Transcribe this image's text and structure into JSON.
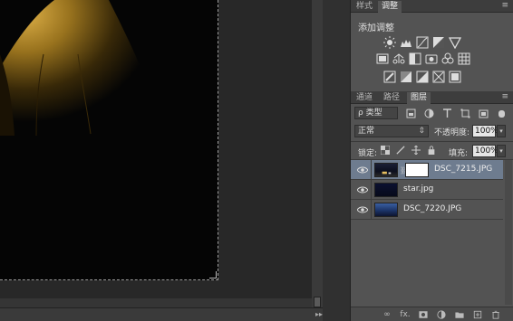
{
  "adjust_panel": {
    "tabs": [
      {
        "label": "样式"
      },
      {
        "label": "调整"
      }
    ],
    "title": "添加调整",
    "menu_icon": "panel-menu-icon"
  },
  "layers_panel": {
    "tabs": [
      {
        "label": "通道"
      },
      {
        "label": "路径"
      },
      {
        "label": "图层"
      }
    ],
    "filter_kind": "ρ 类型",
    "blend_mode": "正常",
    "opacity_label": "不透明度:",
    "opacity_value": "100%",
    "lock_label": "锁定:",
    "fill_label": "填充:",
    "fill_value": "100%",
    "layers": [
      {
        "name": "DSC_7215.JPG",
        "selected": true,
        "has_mask": true
      },
      {
        "name": "star.jpg",
        "selected": false,
        "has_mask": false
      },
      {
        "name": "DSC_7220.JPG",
        "selected": false,
        "has_mask": false
      }
    ],
    "bottom_icons": [
      "link-icon",
      "fx-icon",
      "mask-icon",
      "adjustment-icon",
      "folder-icon",
      "new-layer-icon",
      "trash-icon"
    ],
    "fx_label": "fx."
  },
  "colors": {
    "panel_bg": "#535353",
    "selected_layer": "#6e7c8f",
    "tent_glow": "#c99a2e"
  }
}
